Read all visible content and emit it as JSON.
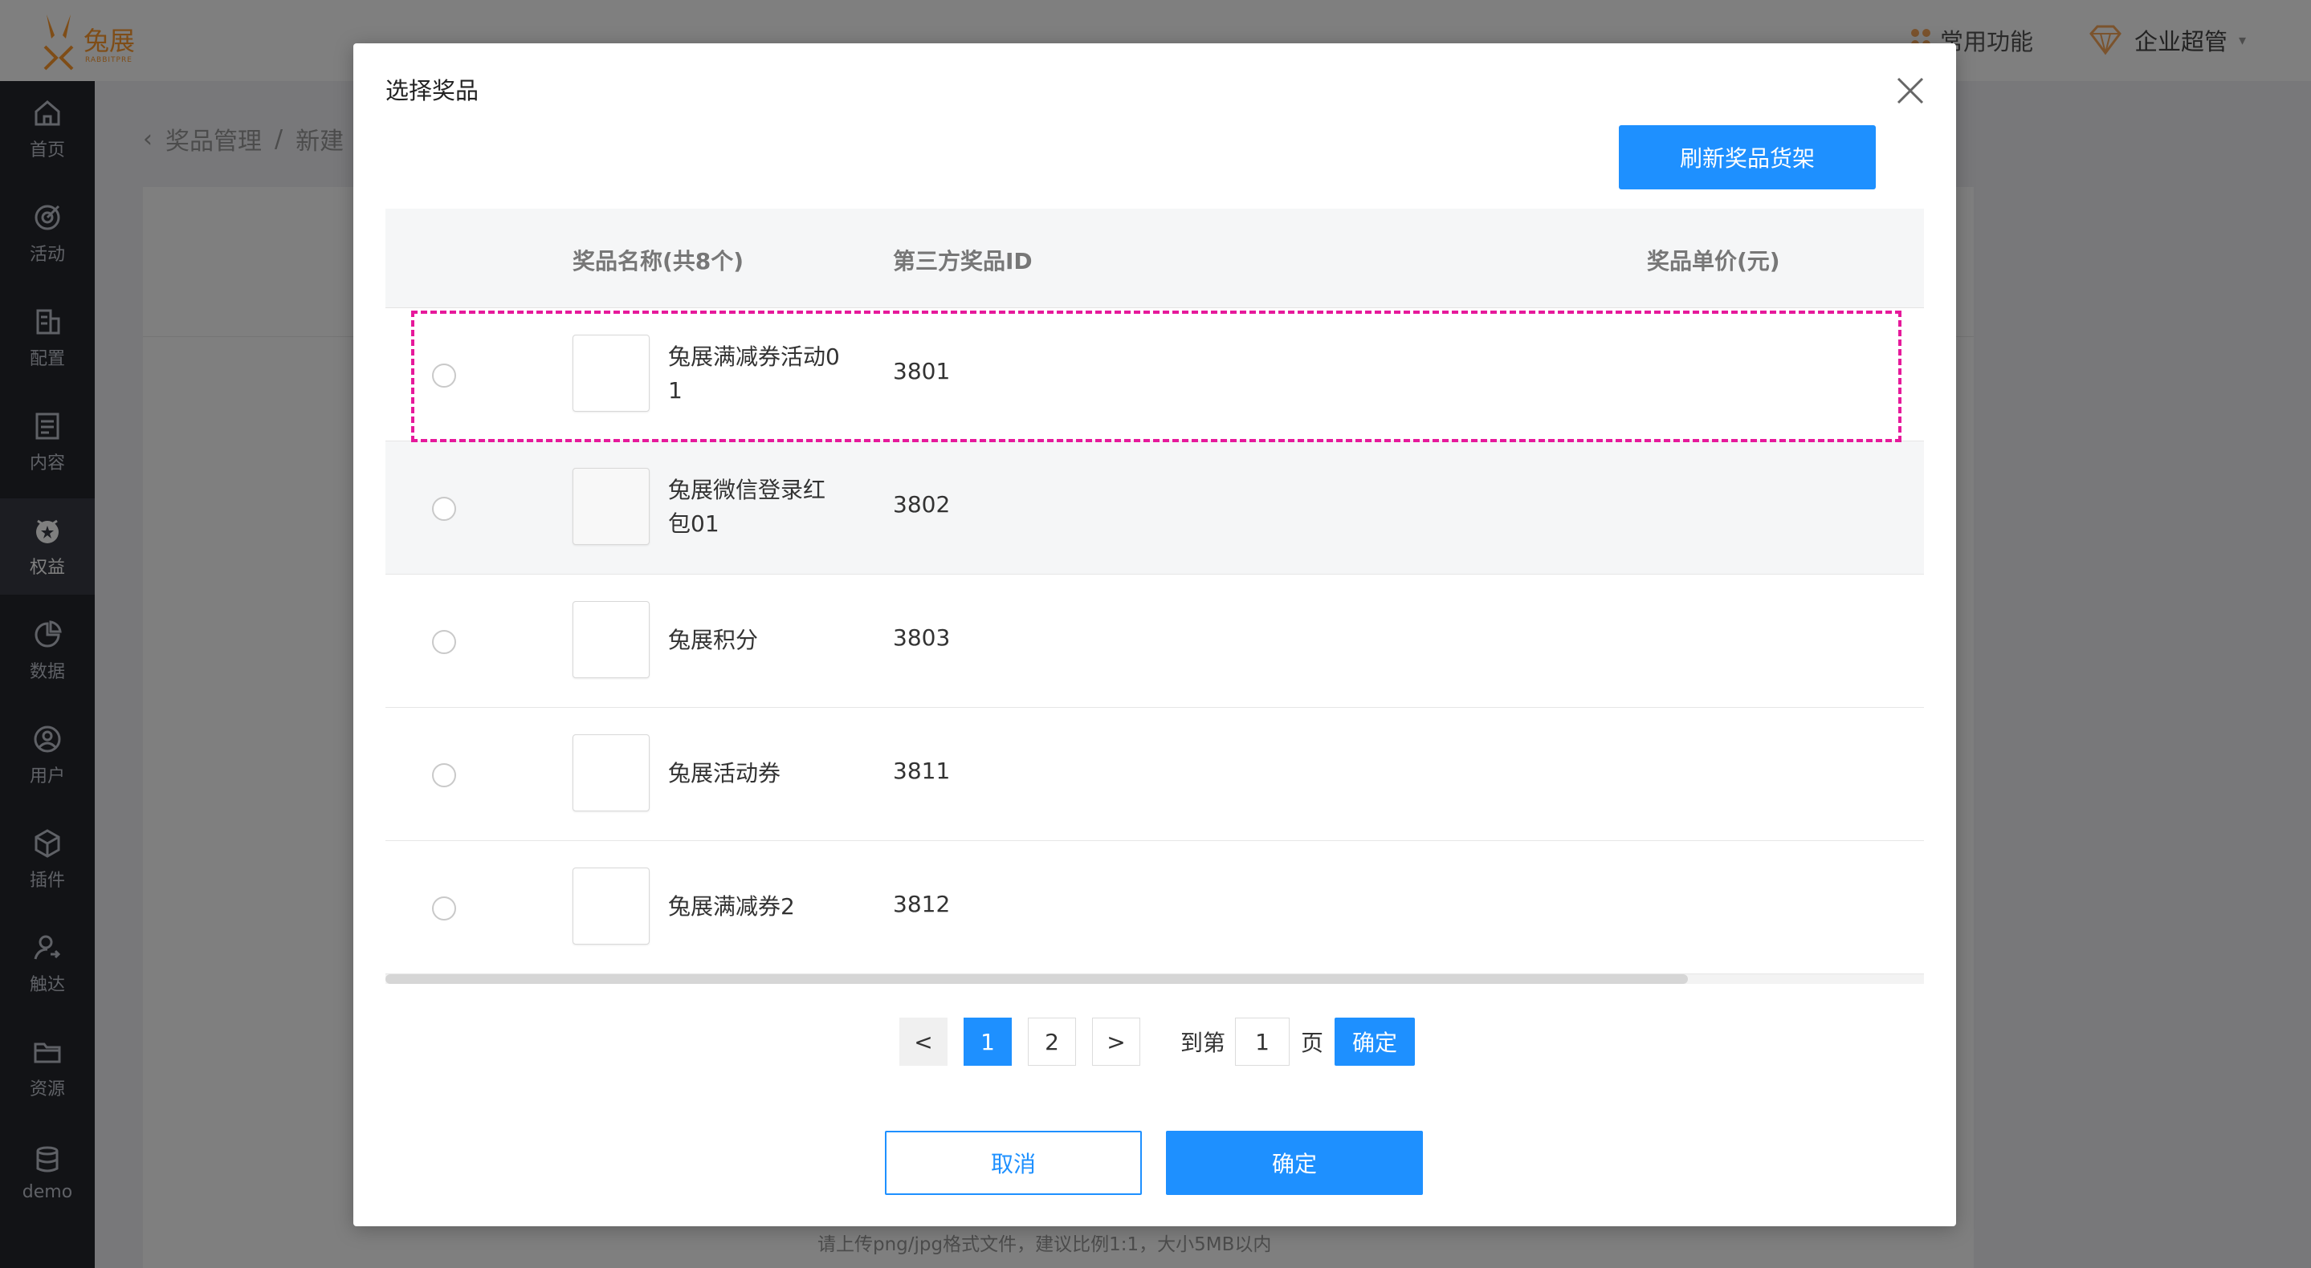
{
  "app": {
    "logo_text": "兔展",
    "logo_sub": "RABBITPRE",
    "common_functions": "常用功能",
    "admin_label": "企业超管"
  },
  "sidebar": {
    "items": [
      {
        "label": "首页",
        "icon": "home-icon"
      },
      {
        "label": "活动",
        "icon": "target-icon"
      },
      {
        "label": "配置",
        "icon": "config-icon"
      },
      {
        "label": "内容",
        "icon": "document-icon"
      },
      {
        "label": "权益",
        "icon": "badge-icon",
        "active": true
      },
      {
        "label": "数据",
        "icon": "pie-chart-icon"
      },
      {
        "label": "用户",
        "icon": "user-circle-icon"
      },
      {
        "label": "插件",
        "icon": "cube-icon"
      },
      {
        "label": "触达",
        "icon": "user-send-icon"
      },
      {
        "label": "资源",
        "icon": "folder-icon"
      },
      {
        "label": "demo",
        "icon": "database-icon"
      }
    ]
  },
  "breadcrumb": {
    "part1": "奖品管理",
    "separator": "/",
    "part2": "新建"
  },
  "background": {
    "upload_tip": "请上传png/jpg格式文件，建议比例1:1，大小5MB以内"
  },
  "modal": {
    "title": "选择奖品",
    "refresh_label": "刷新奖品货架",
    "columns": {
      "name": "奖品名称(共8个)",
      "third_party_id": "第三方奖品ID",
      "unit_price": "奖品单价(元)"
    },
    "rows": [
      {
        "name_line1": "兔展满减券活动0",
        "name_line2": "1",
        "id": "3801"
      },
      {
        "name_line1": "兔展微信登录红",
        "name_line2": "包01",
        "id": "3802"
      },
      {
        "name_line1": "兔展积分",
        "name_line2": "",
        "id": "3803"
      },
      {
        "name_line1": "兔展活动券",
        "name_line2": "",
        "id": "3811"
      },
      {
        "name_line1": "兔展满减券2",
        "name_line2": "",
        "id": "3812"
      }
    ],
    "pagination": {
      "prev": "<",
      "pages": [
        "1",
        "2"
      ],
      "current": "1",
      "next": ">",
      "goto_label": "到第",
      "goto_value": "1",
      "goto_unit": "页",
      "goto_confirm": "确定"
    },
    "cancel_label": "取消",
    "confirm_label": "确定"
  },
  "colors": {
    "primary": "#1e90ff",
    "highlight": "#e6199b",
    "brand_orange": "#ff9a2e"
  }
}
